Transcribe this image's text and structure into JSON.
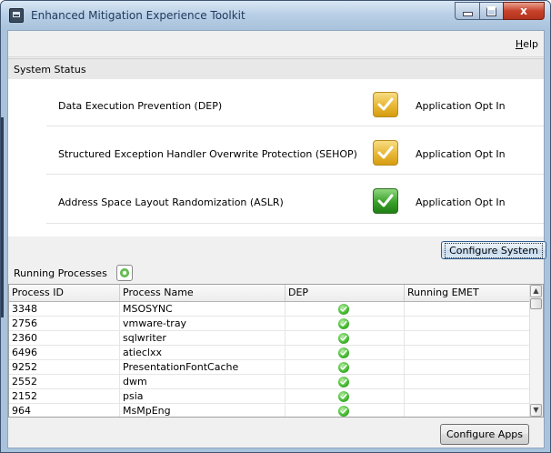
{
  "window": {
    "title": "Enhanced Mitigation Experience Toolkit",
    "controls": {
      "minimize": "minimize",
      "maximize": "maximize",
      "close": "x"
    }
  },
  "menu": {
    "help_prefix": "",
    "help_underlined": "H",
    "help_rest": "elp"
  },
  "system_status": {
    "header": "System Status",
    "items": [
      {
        "label": "Data Execution Prevention (DEP)",
        "status": "Application Opt In",
        "icon": "checkmark-icon",
        "color": "#e8b735"
      },
      {
        "label": "Structured Exception Handler Overwrite Protection (SEHOP)",
        "status": "Application Opt In",
        "icon": "checkmark-icon",
        "color": "#e8b735"
      },
      {
        "label": "Address Space Layout Randomization (ASLR)",
        "status": "Application Opt In",
        "icon": "checkmark-icon",
        "color": "#3aa12a"
      }
    ],
    "configure_button": "Configure System"
  },
  "running_processes": {
    "header": "Running Processes",
    "refresh_icon": "refresh-icon",
    "columns": [
      "Process ID",
      "Process Name",
      "DEP",
      "Running EMET"
    ],
    "rows": [
      {
        "pid": "3348",
        "name": "MSOSYNC",
        "dep": "ok",
        "emet": ""
      },
      {
        "pid": "2756",
        "name": "vmware-tray",
        "dep": "ok",
        "emet": ""
      },
      {
        "pid": "2360",
        "name": "sqlwriter",
        "dep": "ok",
        "emet": ""
      },
      {
        "pid": "6496",
        "name": "atieclxx",
        "dep": "ok",
        "emet": ""
      },
      {
        "pid": "9252",
        "name": "PresentationFontCache",
        "dep": "ok",
        "emet": ""
      },
      {
        "pid": "2552",
        "name": "dwm",
        "dep": "ok",
        "emet": ""
      },
      {
        "pid": "2152",
        "name": "psia",
        "dep": "ok",
        "emet": ""
      },
      {
        "pid": "964",
        "name": "MsMpEng",
        "dep": "ok",
        "emet": ""
      }
    ],
    "configure_button": "Configure Apps"
  }
}
